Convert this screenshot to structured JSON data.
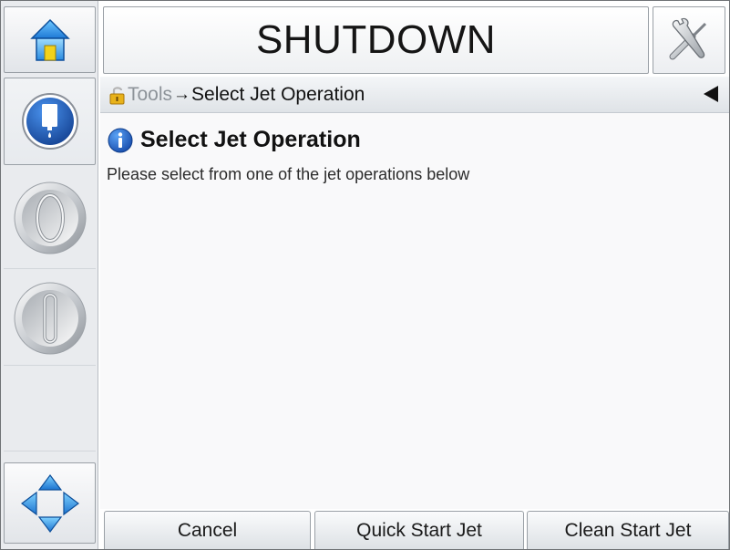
{
  "header": {
    "title": "SHUTDOWN"
  },
  "icons": {
    "home": "home-icon",
    "tools": "tools-icon",
    "ink_status": "ink-bottle-icon",
    "jet_start": "jet-start-icon",
    "jet_stop": "jet-stop-icon",
    "navigation": "navigation-arrows-icon",
    "lock": "lock-icon",
    "back": "back-arrow-icon",
    "info": "info-icon"
  },
  "breadcrumb": {
    "parent": "Tools",
    "separator": "→",
    "current": "Select Jet Operation"
  },
  "main": {
    "heading": "Select Jet Operation",
    "description": "Please select from one of the jet operations below"
  },
  "buttons": {
    "cancel": "Cancel",
    "quick_start": "Quick Start Jet",
    "clean_start": "Clean Start Jet"
  },
  "colors": {
    "accent_blue": "#1c5fc4",
    "home_yellow": "#f2d21b"
  }
}
